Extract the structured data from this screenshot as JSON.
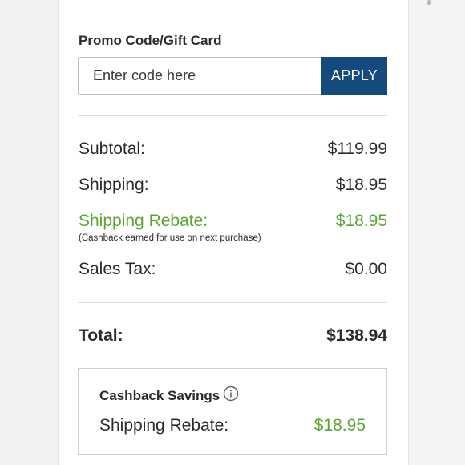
{
  "promo": {
    "label": "Promo Code/Gift Card",
    "input_value": "",
    "input_placeholder": "Enter code here",
    "apply_label": "APPLY"
  },
  "summary": {
    "subtotal_label": "Subtotal:",
    "subtotal_value": "$119.99",
    "shipping_label": "Shipping:",
    "shipping_value": "$18.95",
    "rebate_label": "Shipping Rebate:",
    "rebate_value": "$18.95",
    "rebate_note": "(Cashback earned for use on next purchase)",
    "tax_label": "Sales Tax:",
    "tax_value": "$0.00",
    "total_label": "Total:",
    "total_value": "$138.94"
  },
  "cashback": {
    "title": "Cashback Savings",
    "info_icon": "info-icon",
    "item_label": "Shipping Rebate:",
    "item_value": "$18.95"
  },
  "colors": {
    "accent_button": "#154a7e",
    "rebate_green": "#5aa632",
    "text": "#2b2b2b"
  }
}
